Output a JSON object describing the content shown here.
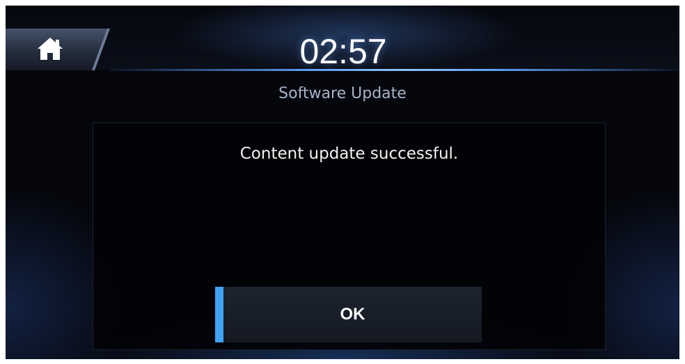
{
  "status_bar": {
    "home_icon": "home-icon",
    "clock": "02:57"
  },
  "screen": {
    "title": "Software Update"
  },
  "dialog": {
    "message": "Content update successful.",
    "ok_label": "OK"
  },
  "colors": {
    "accent": "#3fa2f2",
    "background": "#05070d",
    "title_text": "#a7b3c6"
  }
}
